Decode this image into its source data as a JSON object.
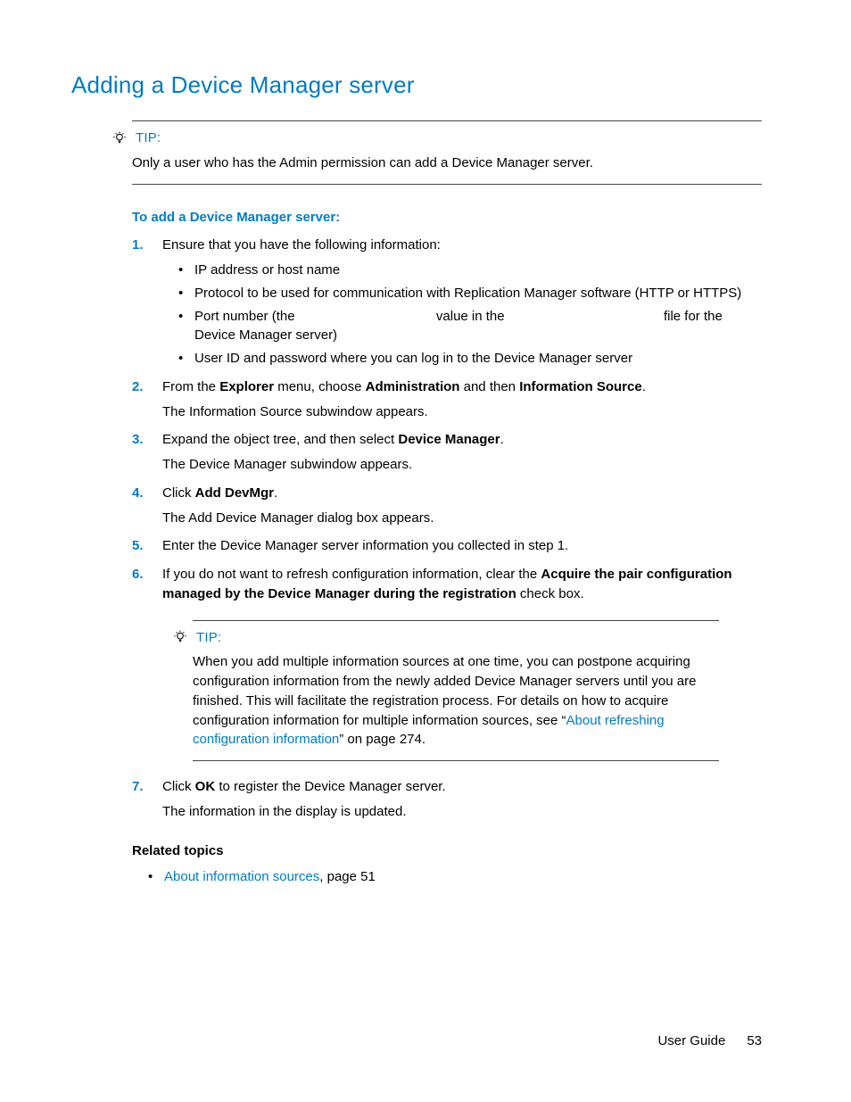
{
  "title": "Adding a Device Manager server",
  "tip1": {
    "label": "TIP:",
    "body": "Only a user who has the Admin permission can add a Device Manager server."
  },
  "subhead": "To add a Device Manager server:",
  "steps": {
    "s1": {
      "text": "Ensure that you have the following information:",
      "bullets": {
        "b1": "IP address or host name",
        "b2": "Protocol to be used for communication with Replication Manager software (HTTP or HTTPS)",
        "b3a": "Port number (the ",
        "b3b": " value in the ",
        "b3c": " file for the Device Manager server)",
        "b4": "User ID and password where you can log in to the Device Manager server"
      }
    },
    "s2": {
      "pre": "From the ",
      "bold1": "Explorer",
      "mid1": " menu, choose ",
      "bold2": "Administration",
      "mid2": " and then ",
      "bold3": "Information Source",
      "post": ".",
      "note": "The Information Source subwindow appears."
    },
    "s3": {
      "pre": "Expand the object tree, and then select ",
      "bold1": "Device Manager",
      "post": ".",
      "note": "The Device Manager subwindow appears."
    },
    "s4": {
      "pre": "Click ",
      "bold1": "Add DevMgr",
      "post": ".",
      "note": "The Add Device Manager dialog box appears."
    },
    "s5": {
      "text": "Enter the Device Manager server information you collected in step 1."
    },
    "s6": {
      "pre": "If you do not want to refresh configuration information, clear the ",
      "bold1": "Acquire the pair configuration managed by the Device Manager during the registration",
      "post": " check box."
    },
    "s7": {
      "pre": "Click ",
      "bold1": "OK",
      "post": " to register the Device Manager server.",
      "note": "The information in the display is updated."
    }
  },
  "tip2": {
    "label": "TIP:",
    "body_pre": "When you add multiple information sources at one time, you can postpone acquiring configuration information from the newly added Device Manager servers until you are finished. This will facilitate the registration process. For details on how to acquire configuration information for multiple information sources, see “",
    "link": "About refreshing configuration information",
    "body_post": "” on page 274."
  },
  "related": {
    "head": "Related topics",
    "item1_link": "About information sources",
    "item1_post": ", page 51"
  },
  "footer": {
    "label": "User Guide",
    "page": "53"
  }
}
